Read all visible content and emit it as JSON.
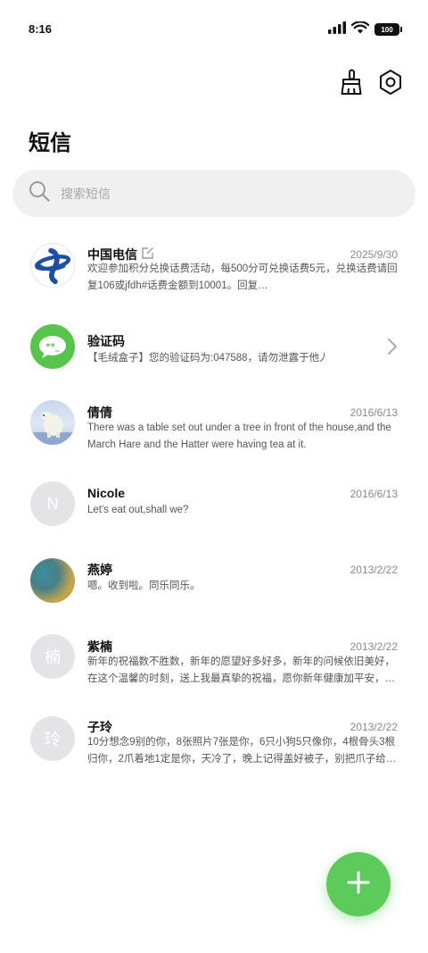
{
  "status_bar": {
    "time": "8:16",
    "battery": "100"
  },
  "top_actions": {
    "clean_icon": "broom-icon",
    "settings_icon": "settings-hex-icon"
  },
  "page": {
    "title": "短信"
  },
  "search": {
    "placeholder": "搜索短信"
  },
  "conversations": [
    {
      "name": "中国电信",
      "date": "2025/9/30",
      "preview": "欢迎参加积分兑换话费活动，每500分可兑换话费5元，兑换话费请回复106或jfdh#话费金额到10001。回复…",
      "avatar": "china-telecom-logo"
    },
    {
      "name": "验证码",
      "date": "",
      "preview": "【毛绒盒子】您的验证码为:047588，请勿泄露于他人!",
      "avatar": "message-bubble-logo"
    },
    {
      "name": "倩倩",
      "date": "2016/6/13",
      "preview": "There was a table set out under a tree in front of the house,and the March Hare and the Hatter were having tea at it.",
      "avatar": "polar-bear-photo"
    },
    {
      "name": "Nicole",
      "date": "2016/6/13",
      "preview": "Let's eat out,shall we?",
      "avatar_letter": "N"
    },
    {
      "name": "燕婷",
      "date": "2013/2/22",
      "preview": "嗯。收到啦。同乐同乐。",
      "avatar": "landscape-photo"
    },
    {
      "name": "紫楠",
      "date": "2013/2/22",
      "preview": "新年的祝福数不胜数，新年的愿望好多好多，新年的问候依旧美好，在这个温馨的时刻，送上我最真挚的祝福，愿你新年健康加平安，幸福又快…",
      "avatar_letter": "楠"
    },
    {
      "name": "子玲",
      "date": "2013/2/22",
      "preview": "10分想念9别的你，8张照片7张是你，6只小狗5只像你，4根骨头3根归你，2爪着地1定是你，天冷了，晚上记得盖好被子，别把爪子给冻坏…",
      "avatar_letter": "玲"
    }
  ],
  "fab": {
    "icon": "plus-icon"
  },
  "colors": {
    "accent": "#5dcb5c",
    "telecom_blue": "#1d4fa6",
    "search_bg": "#f0f0f0"
  }
}
